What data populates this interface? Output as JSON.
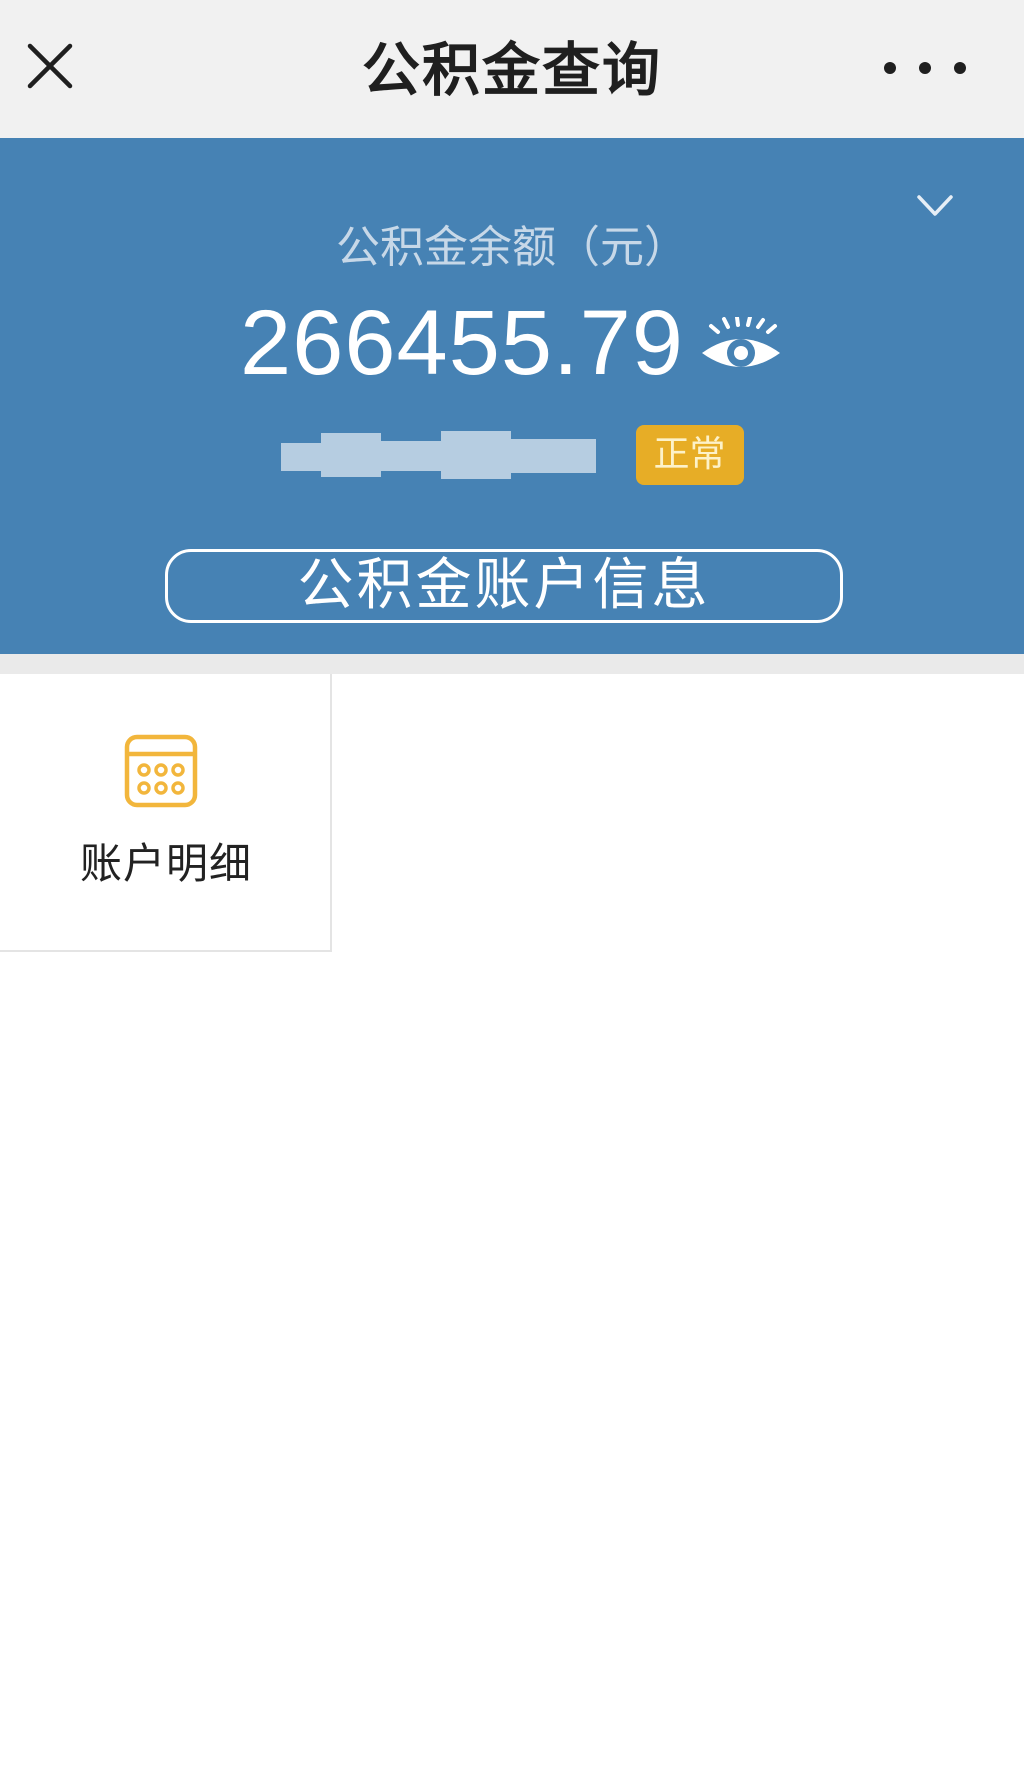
{
  "header": {
    "title": "公积金查询",
    "close_icon": "close-icon",
    "more_icon": "more-dots-icon"
  },
  "summary": {
    "balance_label": "公积金余额（元）",
    "balance": "266455.79",
    "visibility_icon": "eye-icon",
    "status": "正常",
    "expand_icon": "chevron-down-icon",
    "info_button_label": "公积金账户信息"
  },
  "menu": {
    "items": [
      {
        "label": "账户明细",
        "icon": "calendar-grid-icon"
      }
    ]
  },
  "colors": {
    "topbar_bg": "#f1f1f1",
    "hero_bg": "#4682b4",
    "status_badge": "#e7ad26",
    "tile_icon": "#f2b63c"
  }
}
